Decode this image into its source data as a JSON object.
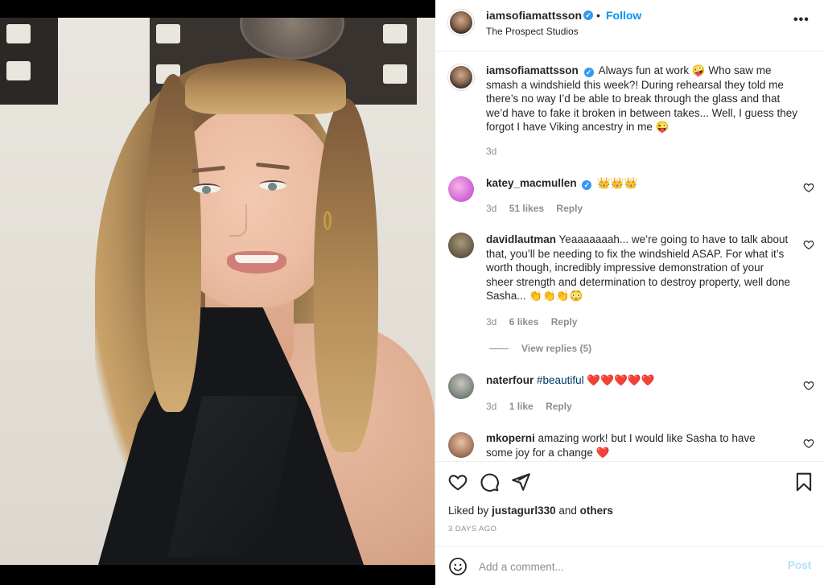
{
  "post": {
    "username": "iamsofiamattsson",
    "follow_label": "Follow",
    "dot": "•",
    "location": "The Prospect Studios",
    "more_label": "•••"
  },
  "caption": {
    "username": "iamsofiamattsson",
    "text": "Always fun at work 🤪 Who saw me smash a windshield this week?! During rehearsal they told me there’s no way I’d be able to break through the glass and that we’d have to fake it broken in between takes... Well, I guess they forgot I have Viking ancestry in me 😜",
    "time": "3d"
  },
  "comments": [
    {
      "username": "katey_macmullen",
      "verified": true,
      "text": "👑👑👑",
      "time": "3d",
      "likes": "51 likes",
      "reply": "Reply"
    },
    {
      "username": "davidlautman",
      "verified": false,
      "text": "Yeaaaaaaah... we’re going to have to talk about that, you’ll be needing to fix the windshield ASAP. For what it’s worth though, incredibly impressive demonstration of your sheer strength and determination to destroy property, well done Sasha... 👏👏👏😳",
      "time": "3d",
      "likes": "6 likes",
      "reply": "Reply",
      "view_replies": "View replies (5)"
    },
    {
      "username": "naterfour",
      "verified": false,
      "hashtag": "#beautiful",
      "text": "❤️❤️❤️❤️❤️",
      "time": "3d",
      "likes": "1 like",
      "reply": "Reply"
    },
    {
      "username": "mkoperni",
      "verified": false,
      "text": "amazing work! but I would like Sasha to have some joy for a change ❤️"
    }
  ],
  "actions": {
    "liked_prefix": "Liked by",
    "liked_user": "justagurl330",
    "liked_and": "and",
    "liked_others": "others",
    "date": "3 DAYS AGO"
  },
  "add_comment": {
    "placeholder": "Add a comment...",
    "post_label": "Post"
  },
  "colors": {
    "link_blue": "#0095f6",
    "verified_blue": "#3897f0",
    "secondary_text": "#8e8e8e",
    "post_disabled": "#b2dffc"
  },
  "icons": [
    "more-icon",
    "verified-icon",
    "heart-icon",
    "comment-icon",
    "share-icon",
    "bookmark-icon",
    "emoji-icon"
  ]
}
